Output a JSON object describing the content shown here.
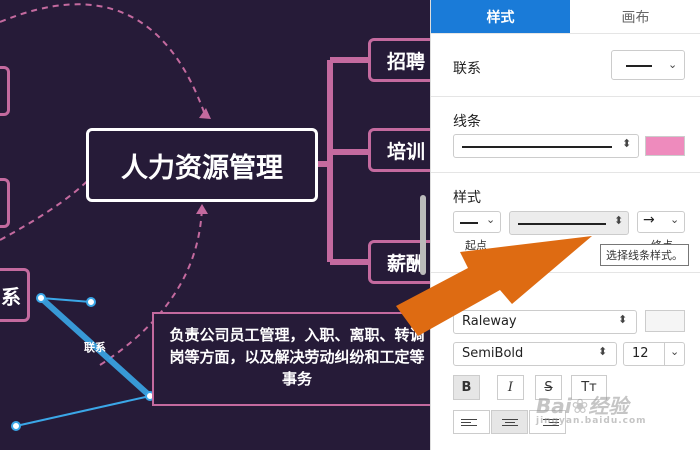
{
  "canvas": {
    "central_topic": "人力资源管理",
    "branches": [
      "招聘",
      "培训",
      "薪酬"
    ],
    "left_node_fragment": "系",
    "relation_label": "联系",
    "description": "负责公司员工管理，入职、离职、转调岗等方面，以及解决劳动纠纷和工定等事务"
  },
  "panel": {
    "tabs": [
      {
        "label": "样式",
        "active": true
      },
      {
        "label": "画布",
        "active": false
      }
    ],
    "relation_label": "联系",
    "line_label": "线条",
    "line_color": "#ee8bbd",
    "style_label": "样式",
    "start_label": "起点",
    "end_label": "终点",
    "tooltip": "选择线条样式。",
    "font_family": "Raleway",
    "font_weight": "SemiBold",
    "font_size": "12",
    "bold_label": "B",
    "italic_label": "I",
    "strike_label": "S",
    "case_label": "Tт"
  },
  "watermark": {
    "text": "Bai❀经验",
    "sub": "jingyan.baidu.com"
  },
  "colors": {
    "canvas_bg": "#261b38",
    "node_border": "#c46a9f",
    "accent": "#1a7bd8",
    "relation_line": "#3ba7e8",
    "arrow": "#de6b12"
  }
}
